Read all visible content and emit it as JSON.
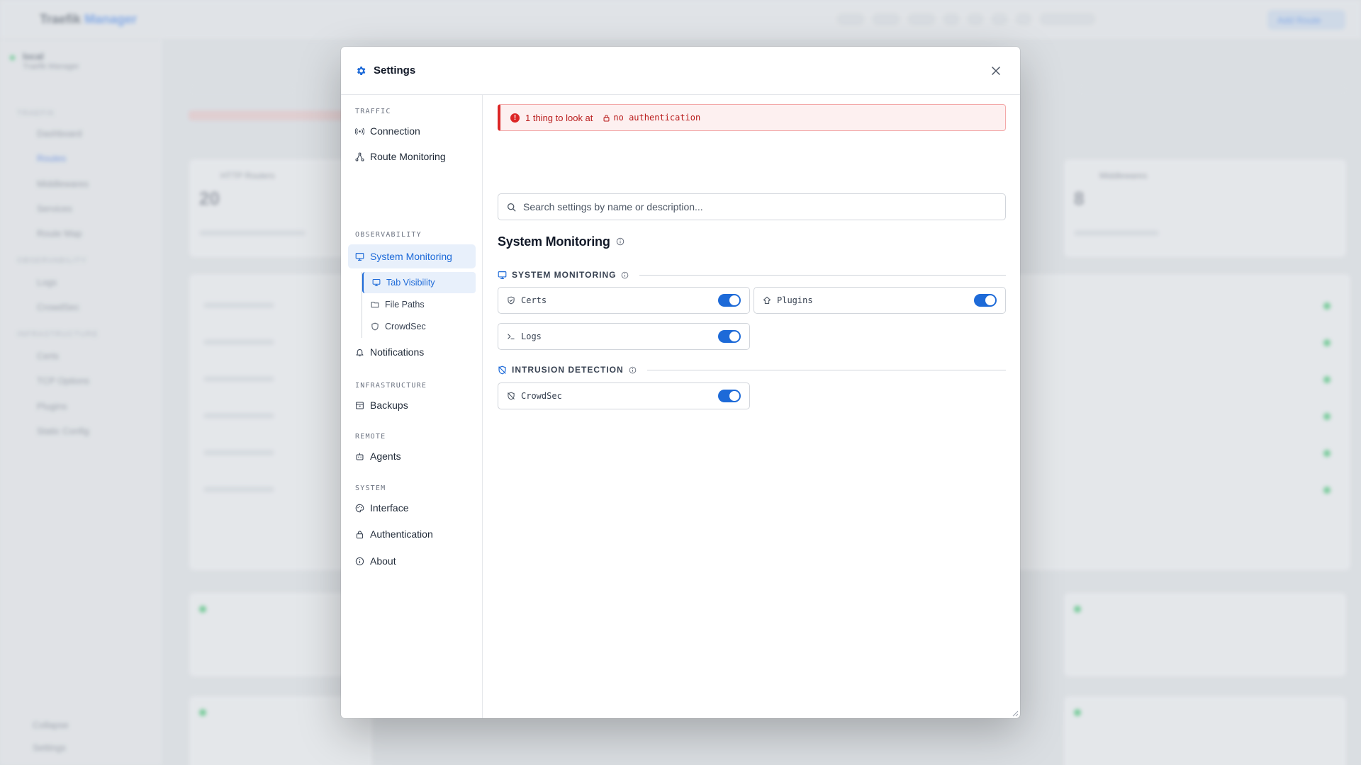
{
  "background_app": {
    "logo_text": "Traefik",
    "logo_accent": "Manager",
    "add_button": "Add Route",
    "sidebar": {
      "status_title": "local",
      "status_subtitle": "Traefik Manager",
      "groups": [
        {
          "heading": "TRAEFIK",
          "items": [
            "Dashboard",
            "Routes",
            "Middlewares",
            "Services",
            "Route Map"
          ]
        },
        {
          "heading": "OBSERVABILITY",
          "items": [
            "Logs",
            "CrowdSec"
          ]
        },
        {
          "heading": "INFRASTRUCTURE",
          "items": [
            "Certs",
            "TCP Options",
            "Plugins",
            "Static Config"
          ]
        }
      ],
      "footer_items": [
        "Collapse",
        "Settings"
      ]
    },
    "cards": {
      "http_routers_title": "HTTP Routers",
      "http_routers_value": "20",
      "middlewares_title": "Middlewares",
      "middlewares_value": "8"
    }
  },
  "modal": {
    "title": "Settings",
    "icon": "gear-icon",
    "nav": {
      "sections": [
        {
          "heading": "TRAFFIC",
          "items": [
            {
              "label": "Connection",
              "icon": "connection-icon"
            },
            {
              "label": "Route Monitoring",
              "icon": "route-icon"
            }
          ]
        },
        {
          "heading": "OBSERVABILITY",
          "items": [
            {
              "label": "System Monitoring",
              "icon": "monitor-icon",
              "active": true
            },
            {
              "label": "Notifications",
              "icon": "bell-icon"
            }
          ]
        },
        {
          "heading": "INFRASTRUCTURE",
          "items": [
            {
              "label": "Backups",
              "icon": "archive-icon"
            }
          ]
        },
        {
          "heading": "REMOTE",
          "items": [
            {
              "label": "Agents",
              "icon": "agent-icon"
            }
          ]
        },
        {
          "heading": "SYSTEM",
          "items": [
            {
              "label": "Interface",
              "icon": "palette-icon"
            },
            {
              "label": "Authentication",
              "icon": "lock-icon"
            },
            {
              "label": "About",
              "icon": "info-icon"
            }
          ]
        }
      ],
      "sub_items": [
        {
          "label": "Tab Visibility",
          "icon": "monitor-icon",
          "active": true
        },
        {
          "label": "File Paths",
          "icon": "folder-icon"
        },
        {
          "label": "CrowdSec",
          "icon": "shield-icon"
        }
      ]
    },
    "alert": {
      "text": "1 thing to look at",
      "tag": "no authentication",
      "color": "#dc2626"
    },
    "search": {
      "placeholder": "Search settings by name or description...",
      "value": ""
    },
    "page_title": "System Monitoring",
    "sections": [
      {
        "title": "SYSTEM MONITORING",
        "toggles": [
          {
            "name": "Certs",
            "icon": "shield-check-icon",
            "on": true
          },
          {
            "name": "Plugins",
            "icon": "plugin-icon",
            "on": true
          },
          {
            "name": "Logs",
            "icon": "terminal-icon",
            "on": true
          }
        ]
      },
      {
        "title": "INTRUSION DETECTION",
        "toggles": [
          {
            "name": "CrowdSec",
            "icon": "shield-off-icon",
            "on": true
          }
        ]
      }
    ],
    "accent_color": "#1d6ad8"
  }
}
